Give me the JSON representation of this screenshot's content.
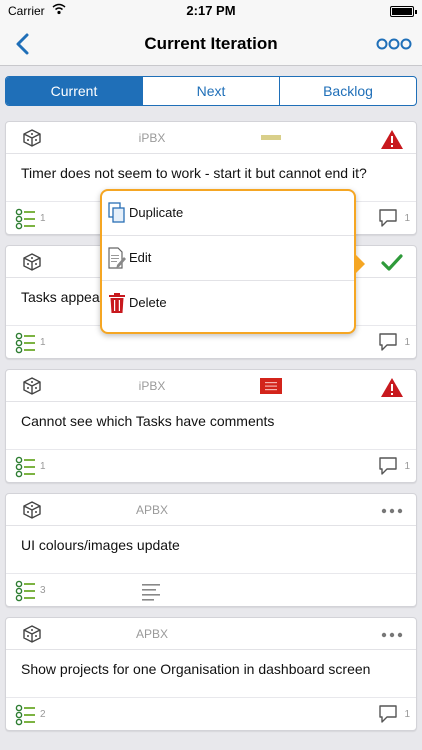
{
  "statusbar": {
    "carrier": "Carrier",
    "time": "2:17 PM"
  },
  "navbar": {
    "title": "Current Iteration",
    "back_icon": "chevron-left-icon",
    "more_icon": "more-circles-icon"
  },
  "accent": "#1f6fb8",
  "segments": [
    {
      "label": "Current",
      "selected": true
    },
    {
      "label": "Next",
      "selected": false
    },
    {
      "label": "Backlog",
      "selected": false
    }
  ],
  "cards": [
    {
      "project": "iPBX",
      "priority": "low",
      "status": "warning",
      "title": "Timer does not seem to work - start it but cannot end it?",
      "tasks": "1",
      "comments": "1"
    },
    {
      "project": "",
      "priority": "",
      "status": "done",
      "title": "Tasks appea",
      "tasks": "1",
      "comments": "1"
    },
    {
      "project": "iPBX",
      "priority": "high",
      "status": "warning",
      "title": "Cannot see which Tasks have comments",
      "tasks": "1",
      "comments": "1"
    },
    {
      "project": "APBX",
      "priority": "",
      "status": "more",
      "title": "UI colours/images update",
      "tasks": "3",
      "comments": ""
    },
    {
      "project": "APBX",
      "priority": "",
      "status": "more",
      "title": "Show projects for one Organisation in dashboard screen",
      "tasks": "2",
      "comments": "1"
    }
  ],
  "popover": {
    "border_color": "#f5a623",
    "items": [
      {
        "label": "Duplicate",
        "icon": "duplicate-icon"
      },
      {
        "label": "Edit",
        "icon": "edit-icon"
      },
      {
        "label": "Delete",
        "icon": "trash-icon"
      }
    ]
  }
}
